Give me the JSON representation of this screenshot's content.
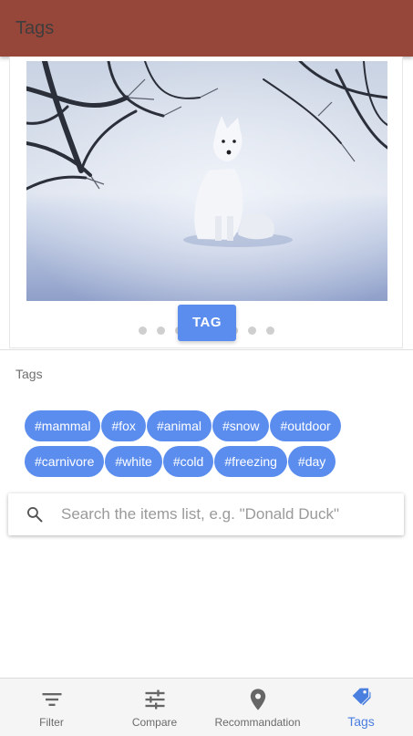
{
  "appbar": {
    "title": "Tags",
    "color": "#97463a"
  },
  "carousel": {
    "image_subject": "arctic fox sitting in snow",
    "tag_button_label": "TAG",
    "dot_count": 8,
    "accent": "#5b8def"
  },
  "tags_section": {
    "label": "Tags",
    "chips": [
      [
        "#mammal",
        "#fox",
        "#animal",
        "#snow",
        "#outdoor"
      ],
      [
        "#carnivore",
        "#white",
        "#cold",
        "#freezing",
        "#day"
      ]
    ]
  },
  "search": {
    "icon": "search-icon",
    "placeholder": "Search the items list, e.g. \"Donald Duck\"",
    "value": ""
  },
  "bottom_nav": {
    "items": [
      {
        "label": "Filter",
        "icon": "filter-icon",
        "active": false
      },
      {
        "label": "Compare",
        "icon": "sliders-icon",
        "active": false
      },
      {
        "label": "Recommandation",
        "icon": "location-pin-icon",
        "active": false
      },
      {
        "label": "Tags",
        "icon": "tag-icon",
        "active": true
      }
    ],
    "active_color": "#4a7fe0"
  }
}
